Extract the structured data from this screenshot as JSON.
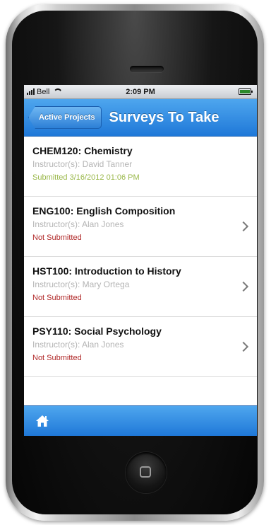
{
  "status_bar": {
    "carrier": "Bell",
    "time": "2:09 PM"
  },
  "nav": {
    "back_label": "Active Projects",
    "title": "Surveys To Take"
  },
  "surveys": [
    {
      "course": "CHEM120: Chemistry",
      "instructor": "Instructor(s): David Tanner",
      "status": "Submitted 3/16/2012 01:06 PM"
    },
    {
      "course": "ENG100: English Composition",
      "instructor": "Instructor(s): Alan Jones",
      "status": "Not Submitted"
    },
    {
      "course": "HST100: Introduction to History",
      "instructor": "Instructor(s): Mary Ortega",
      "status": "Not Submitted"
    },
    {
      "course": "PSY110: Social Psychology",
      "instructor": "Instructor(s): Alan Jones",
      "status": "Not Submitted"
    }
  ],
  "toolbar": {
    "home_icon": "home-icon"
  },
  "colors": {
    "nav_blue": "#2d86e0",
    "submitted_green": "#9ab84a",
    "not_submitted_red": "#b02828"
  }
}
